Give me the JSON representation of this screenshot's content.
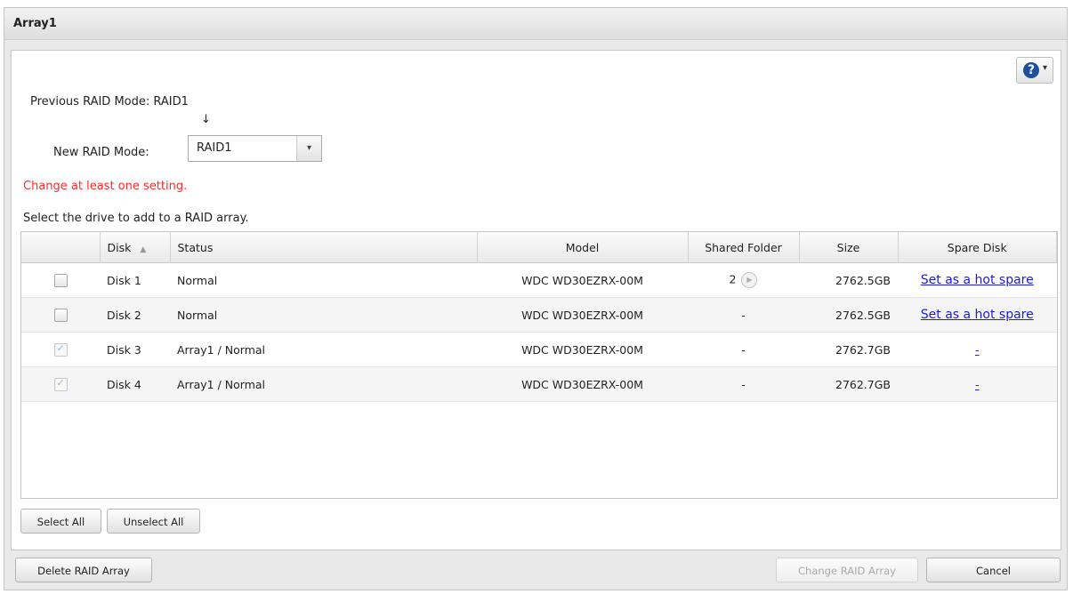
{
  "window": {
    "title": "Array1"
  },
  "help": {
    "icon": "question-icon",
    "label": "?",
    "caret": "▾"
  },
  "raid": {
    "previous_label": "Previous RAID Mode:",
    "previous_value": "RAID1",
    "arrow": "↓",
    "new_label": "New RAID Mode:",
    "new_value": "RAID1",
    "dropdown_glyph": "▾"
  },
  "warning": "Change at least one setting.",
  "instruction": "Select the drive to add to a RAID array.",
  "table": {
    "columns": {
      "disk": "Disk",
      "sort_glyph": "▲",
      "status": "Status",
      "model": "Model",
      "shared_folder": "Shared Folder",
      "size": "Size",
      "spare_disk": "Spare Disk"
    },
    "rows": [
      {
        "checked": false,
        "disk": "Disk 1",
        "status": "Normal",
        "model": "WDC WD30EZRX-00M",
        "shared_folder": "2",
        "size": "2762.5GB",
        "spare": "Set as a hot spare"
      },
      {
        "checked": false,
        "disk": "Disk 2",
        "status": "Normal",
        "model": "WDC WD30EZRX-00M",
        "shared_folder": "-",
        "size": "2762.5GB",
        "spare": "Set as a hot spare"
      },
      {
        "checked": true,
        "disk": "Disk 3",
        "status": "Array1 / Normal",
        "model": "WDC WD30EZRX-00M",
        "shared_folder": "-",
        "size": "2762.7GB",
        "spare": "-"
      },
      {
        "checked": true,
        "disk": "Disk 4",
        "status": "Array1 / Normal",
        "model": "WDC WD30EZRX-00M",
        "shared_folder": "-",
        "size": "2762.7GB",
        "spare": "-"
      }
    ]
  },
  "buttons": {
    "select_all": "Select All",
    "unselect_all": "Unselect All",
    "delete_array": "Delete RAID Array",
    "change_array": "Change RAID Array",
    "cancel": "Cancel"
  },
  "colors": {
    "warning": "#ff2a2a",
    "link": "#1a1ae0",
    "help_icon": "#1e4f9c"
  }
}
